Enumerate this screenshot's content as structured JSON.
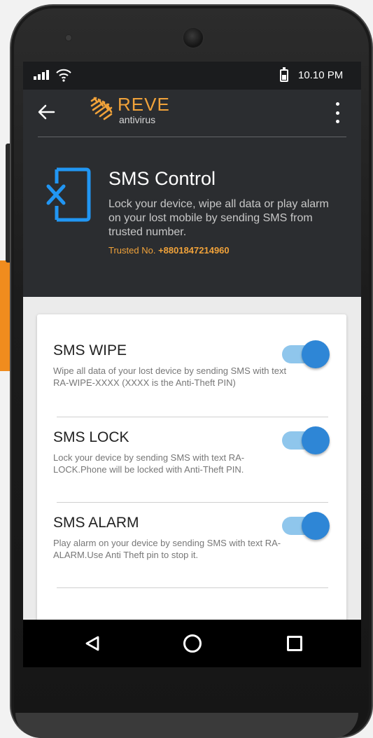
{
  "status_bar": {
    "time": "10.10 PM"
  },
  "app_bar": {
    "logo_title": "REVE",
    "logo_subtitle": "antivirus",
    "back_icon": "back-arrow-icon",
    "menu_icon": "more-vert-icon"
  },
  "header": {
    "icon": "sms-control-icon",
    "title": "SMS Control",
    "description": "Lock your device, wipe all data or play alarm on your lost mobile by sending SMS from trusted number.",
    "trusted_label": "Trusted No.",
    "trusted_number": "+8801847214960"
  },
  "settings": [
    {
      "title": "SMS WIPE",
      "description": "Wipe all data of your lost device by sending SMS with text RA-WIPE-XXXX (XXXX is the Anti-Theft PIN)",
      "enabled": true
    },
    {
      "title": "SMS LOCK",
      "description": "Lock your device by sending SMS with text RA-LOCK.Phone will be locked with Anti-Theft PIN.",
      "enabled": true
    },
    {
      "title": "SMS ALARM",
      "description": "Play alarm on your device by sending SMS with text RA-ALARM.Use Anti Theft pin to stop it.",
      "enabled": true
    }
  ],
  "nav_bar": {
    "back_icon": "triangle-back-icon",
    "home_icon": "circle-home-icon",
    "recents_icon": "square-recents-icon"
  },
  "colors": {
    "accent_orange": "#f0a23a",
    "toggle_on": "#2e86d6",
    "toggle_track": "#8fc6ec",
    "dark_bg": "#2b2d30"
  }
}
